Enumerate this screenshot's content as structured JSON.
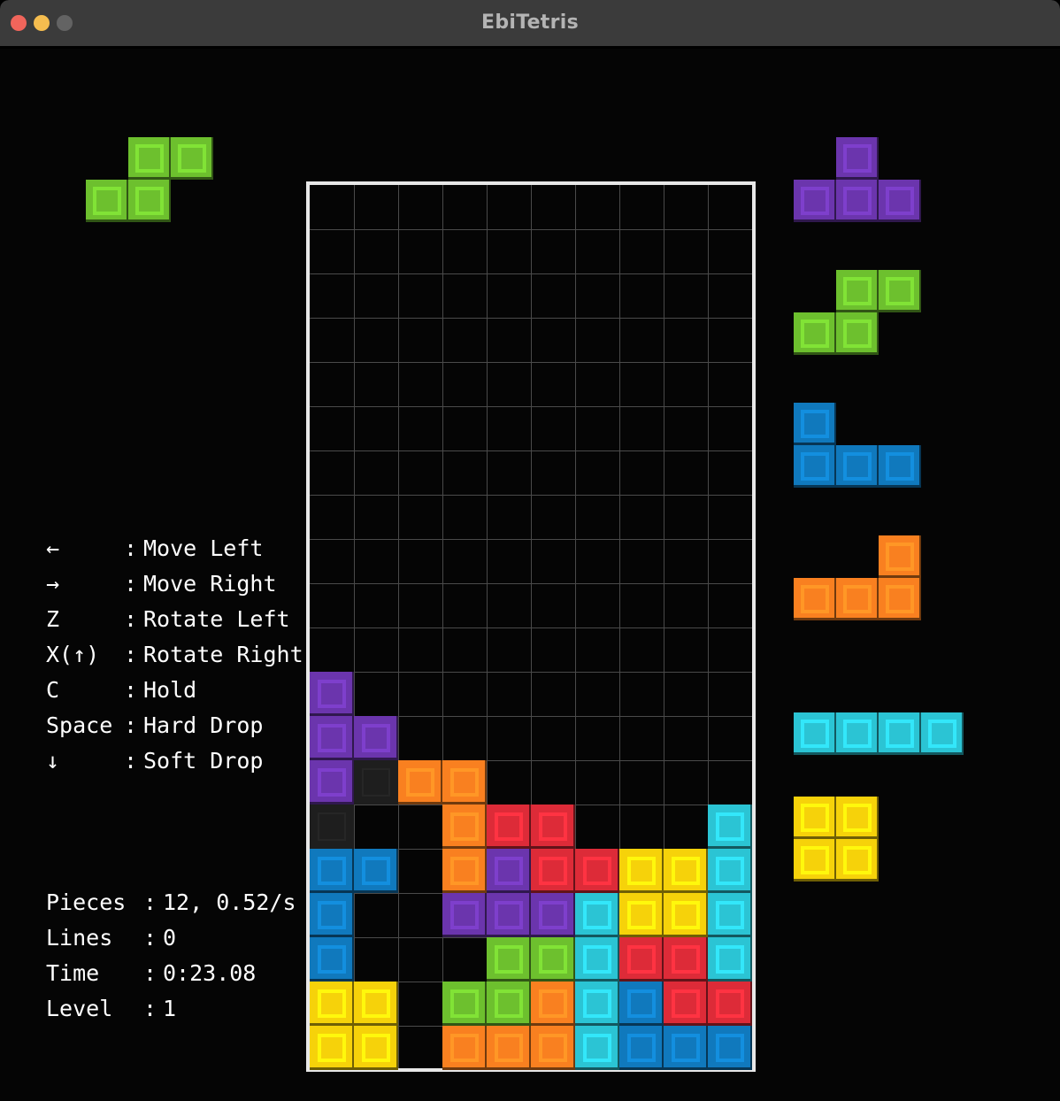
{
  "window": {
    "title": "EbiTetris",
    "traffic_lights": [
      {
        "name": "close-button",
        "color": "#f0655b"
      },
      {
        "name": "minimize-button",
        "color": "#f5bd4f"
      },
      {
        "name": "maximize-button",
        "color": "#636363"
      }
    ]
  },
  "colors": {
    "background": "#000000",
    "board_background": "#050505",
    "board_border": "#e8e8e8",
    "gridline": "#4a4a4a",
    "text": "#ffffff",
    "title_text": "#b4b4b4",
    "titlebar": "#3b3b3b",
    "piece_I": "#2bc4d4",
    "piece_J": "#1079bd",
    "piece_L": "#f98020",
    "piece_O": "#f6d20a",
    "piece_S": "#6dc02e",
    "piece_T": "#6b35ad",
    "piece_Z": "#dd2b38",
    "ghost": "#1e1e1e"
  },
  "board": {
    "columns": 10,
    "rows": 20,
    "cell_size": 50,
    "legend": {
      "I": "cyan",
      "J": "blue",
      "L": "orange",
      "O": "yellow",
      "S": "green",
      "T": "purple",
      "Z": "red",
      "G": "ghost",
      ".": "empty"
    },
    "grid": [
      "..........",
      "..........",
      "..........",
      "..........",
      "..........",
      "..........",
      "..........",
      "..........",
      "..........",
      "..........",
      "..........",
      "T.........",
      "TT........",
      "TGLL......",
      "G..LZZ...I",
      "JJ.LTZZOOI",
      "J..TTTIOOI",
      "J...SSIZZI",
      "OO.SSLIJZZ",
      "OO.LLLIJJJ"
    ]
  },
  "hold": {
    "label": "hold-piece",
    "piece": "S",
    "color": "#6dc02e",
    "shape": [
      ".XX",
      "XX.",
      "..."
    ]
  },
  "next_queue": [
    {
      "piece": "T",
      "color": "#6b35ad",
      "shape": [
        ".X.",
        "XXX"
      ]
    },
    {
      "piece": "S",
      "color": "#6dc02e",
      "shape": [
        ".XX",
        "XX."
      ]
    },
    {
      "piece": "J",
      "color": "#1079bd",
      "shape": [
        "X..",
        "XXX"
      ]
    },
    {
      "piece": "L",
      "color": "#f98020",
      "shape": [
        "..X",
        "XXX"
      ]
    },
    {
      "piece": "I",
      "color": "#2bc4d4",
      "shape": [
        "XXXX"
      ]
    },
    {
      "piece": "O",
      "color": "#f6d20a",
      "shape": [
        "XX",
        "XX"
      ]
    }
  ],
  "controls": {
    "heading": "controls",
    "separator": ":",
    "items": [
      {
        "key": "←",
        "action": "Move Left"
      },
      {
        "key": "→",
        "action": "Move Right"
      },
      {
        "key": "Z",
        "action": "Rotate Left"
      },
      {
        "key": "X(↑)",
        "action": "Rotate Right"
      },
      {
        "key": "C",
        "action": "Hold"
      },
      {
        "key": "Space",
        "action": "Hard Drop"
      },
      {
        "key": "↓",
        "action": "Soft Drop"
      }
    ]
  },
  "stats": {
    "separator": ":",
    "items": [
      {
        "key": "Pieces",
        "value": "12, 0.52/s"
      },
      {
        "key": "Lines",
        "value": "0"
      },
      {
        "key": "Time",
        "value": "0:23.08"
      },
      {
        "key": "Level",
        "value": "1"
      }
    ]
  }
}
